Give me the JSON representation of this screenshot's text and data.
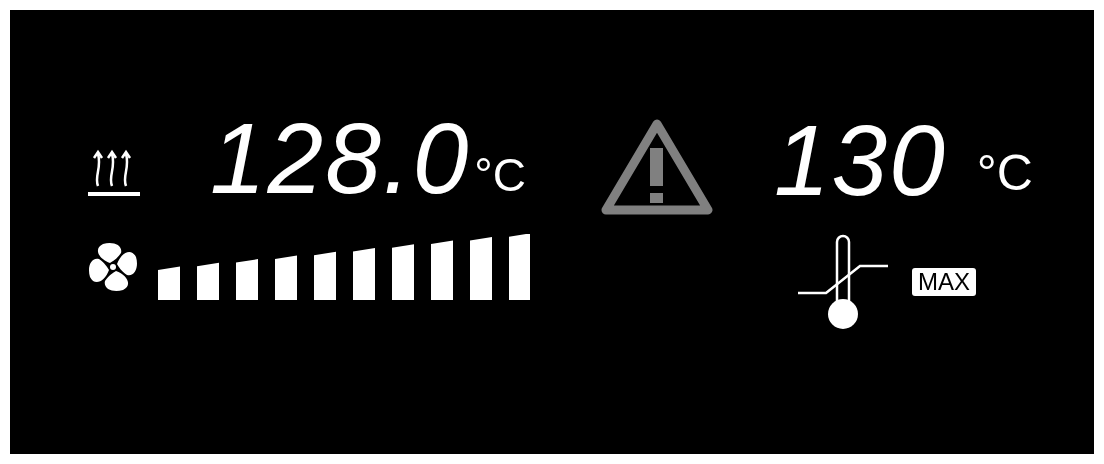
{
  "actual_temperature": {
    "value": "128.0",
    "unit": "°C"
  },
  "setpoint": {
    "value": "130",
    "unit": "°C"
  },
  "limit": {
    "badge": "MAX"
  }
}
